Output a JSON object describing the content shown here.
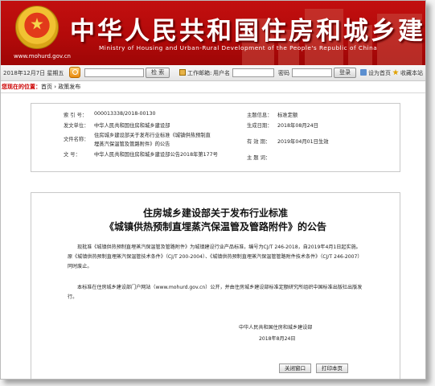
{
  "header": {
    "title": "中华人民共和国住房和城乡建设部",
    "subtitle": "Ministry of Housing and Urban-Rural Development of the People's Republic of China",
    "url": "www.mohurd.gov.cn"
  },
  "toolbar": {
    "date": "2018年12月7日 星期五",
    "search_button": "检  索",
    "mailbox_label": "工作邮箱:",
    "username_label": "用户名",
    "password_label": "密码",
    "login_button": "登录",
    "set_homepage": "设为首页",
    "bookmark": "收藏本站"
  },
  "breadcrumb": {
    "label": "您现在的位置：",
    "path": "首页 › 政策发布"
  },
  "info": {
    "index_label": "索 引 号：",
    "index_value": "000013338/2018-00130",
    "publisher_label": "发文单位：",
    "publisher_value": "中华人民共和国住房和城乡建设部",
    "docname_label": "文件名称：",
    "docname_value": "住房城乡建设部关于发布行业标准《城镇供热预制直埋蒸汽保温管及管路附件》的公告",
    "docno_label": "文 号：",
    "docno_value": "中华人民共和国住房和城乡建设部公告2018年第177号",
    "topic_label": "主题信息：",
    "topic_value": "标准定额",
    "gen_date_label": "生成日期：",
    "gen_date_value": "2018年08月24日",
    "validity_label": "有 效 期：",
    "validity_value": "2019年04月01日生效",
    "keywords_label": "主 题 词："
  },
  "article": {
    "title_line1": "住房城乡建设部关于发布行业标准",
    "title_line2": "《城镇供热预制直埋蒸汽保温管及管路附件》的公告",
    "para1": "现批准《城镇供热预制直埋蒸汽保温管及管路附件》为城镇建设行业产品标准，编号为CJ/T 246-2018，自2019年4月1日起实施。原《城镇供热预制直埋蒸汽保温管技术条件》（CJ/T 200-2004）、《城镇供热预制直埋蒸汽保温管管路附件技术条件》（CJ/T 246-2007）同时废止。",
    "para2": "本标准在住房城乡建设部门户网站（www.mohurd.gov.cn）公开，并由住房城乡建设部标准定额研究所组织中国标准出版社出版发行。",
    "sign_org": "中华人民共和国住房和城乡建设部",
    "sign_date": "2018年8月24日",
    "close_button": "关闭窗口",
    "print_button": "打印本页"
  },
  "colors": {
    "banner_red": "#b30a0a",
    "breadcrumb_label": "#cc0000"
  }
}
